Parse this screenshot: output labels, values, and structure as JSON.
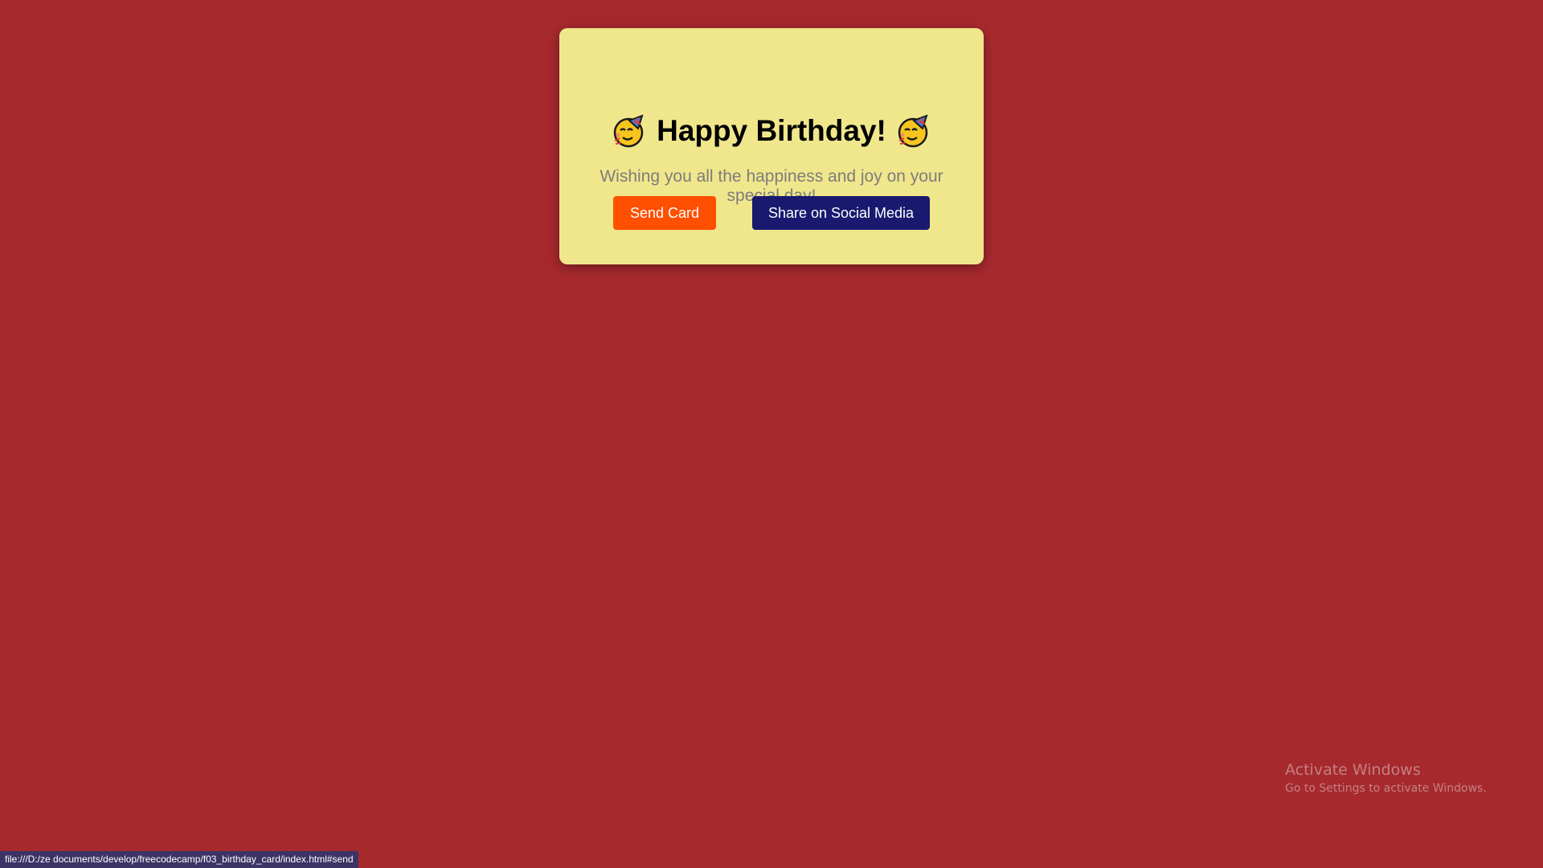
{
  "card": {
    "title": "Happy Birthday!",
    "title_emoji_left": "partying-face-icon",
    "title_emoji_right": "partying-face-icon",
    "message": "Wishing you all the happiness and joy on your special day!",
    "buttons": {
      "send_label": "Send Card",
      "share_label": "Share on Social Media"
    }
  },
  "status_bar": {
    "url": "file:///D:/ze documents/develop/freecodecamp/f03_birthday_card/index.html#send"
  },
  "watermark": {
    "title": "Activate Windows",
    "subtitle": "Go to Settings to activate Windows."
  },
  "colors": {
    "page_background": "#a6292e",
    "card_background": "#f0e68c",
    "send_button": "#ff4f00",
    "share_button": "#191970",
    "message_text": "#7d7d7d"
  }
}
